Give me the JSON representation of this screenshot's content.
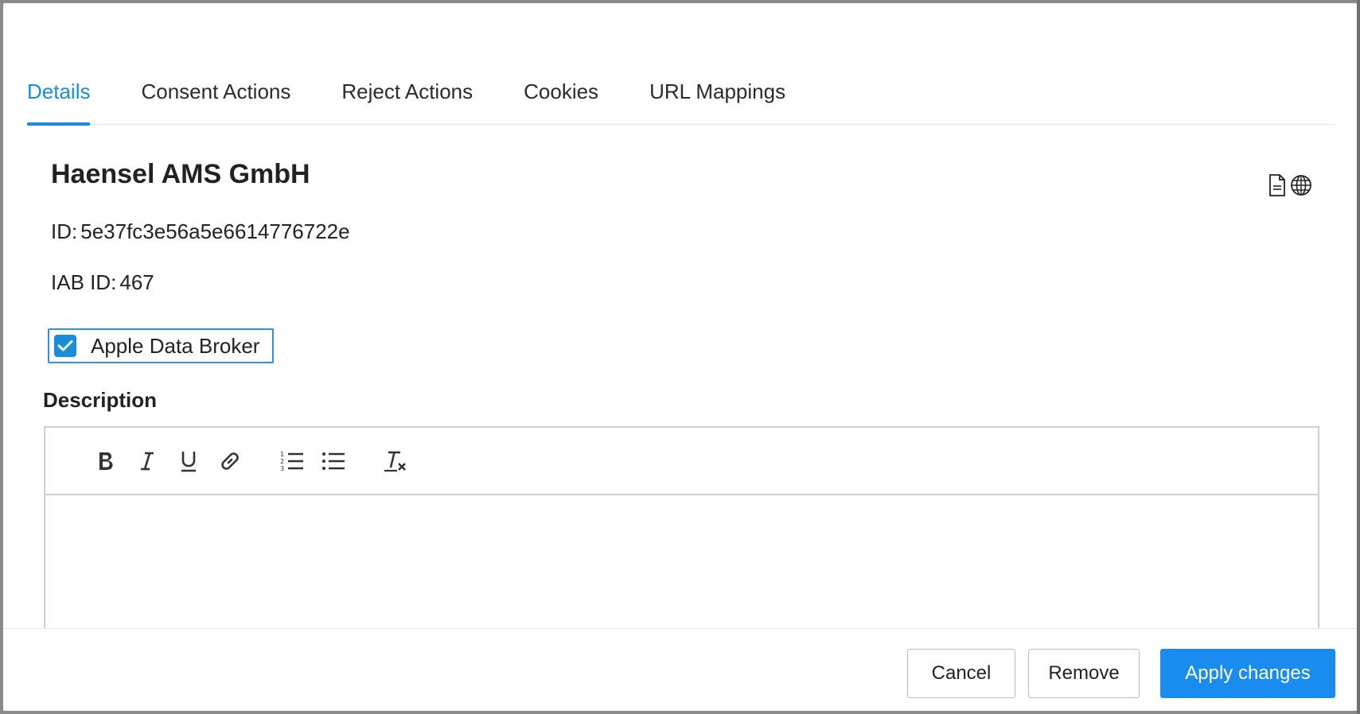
{
  "tabs": [
    {
      "label": "Details",
      "active": true
    },
    {
      "label": "Consent Actions",
      "active": false
    },
    {
      "label": "Reject Actions",
      "active": false
    },
    {
      "label": "Cookies",
      "active": false
    },
    {
      "label": "URL Mappings",
      "active": false
    }
  ],
  "vendor": {
    "name": "Haensel AMS GmbH",
    "id_label": "ID:",
    "id_value": "5e37fc3e56a5e6614776722e",
    "iab_label": "IAB ID:",
    "iab_value": "467"
  },
  "header_icons": [
    "document-icon",
    "globe-icon"
  ],
  "checkbox": {
    "label": "Apple Data Broker",
    "checked": true
  },
  "description": {
    "label": "Description",
    "toolbar": [
      "bold-icon",
      "italic-icon",
      "underline-icon",
      "link-icon",
      "ordered-list-icon",
      "bullet-list-icon",
      "clear-format-icon"
    ],
    "content": ""
  },
  "footer": {
    "cancel_label": "Cancel",
    "remove_label": "Remove",
    "apply_label": "Apply changes"
  },
  "colors": {
    "accent": "#1a8cdd",
    "primary_button": "#1a8cf0",
    "checkbox_focus_border": "#2f8ff0"
  }
}
